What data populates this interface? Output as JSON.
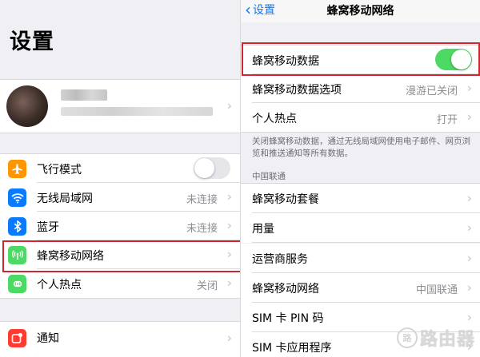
{
  "left": {
    "title": "设置",
    "main_rows": [
      {
        "icon": "airplane-icon",
        "color": "#ff9500",
        "label": "飞行模式",
        "type": "toggle",
        "on": false
      },
      {
        "icon": "wifi-icon",
        "color": "#0a7aff",
        "label": "无线局域网",
        "detail": "未连接"
      },
      {
        "icon": "bluetooth-icon",
        "color": "#0a7aff",
        "label": "蓝牙",
        "detail": "未连接"
      },
      {
        "icon": "cellular-icon",
        "color": "#4cd964",
        "label": "蜂窝移动网络",
        "detail": ""
      },
      {
        "icon": "hotspot-icon",
        "color": "#4cd964",
        "label": "个人热点",
        "detail": "关闭"
      }
    ],
    "notify_row": {
      "icon": "notifications-icon",
      "color": "#ff3b30",
      "label": "通知"
    }
  },
  "right": {
    "back_label": "设置",
    "title": "蜂窝移动网络",
    "data_row": {
      "label": "蜂窝移动数据",
      "on": true
    },
    "options_row": {
      "label": "蜂窝移动数据选项",
      "detail": "漫游已关闭"
    },
    "hotspot_row": {
      "label": "个人热点",
      "detail": "打开"
    },
    "footnote": "关闭蜂窝移动数据，通过无线局域网使用电子邮件、网页浏览和推送通知等所有数据。",
    "carrier_header": "中国联通",
    "carrier_rows": [
      {
        "label": "蜂窝移动套餐",
        "detail": ""
      },
      {
        "label": "用量",
        "detail": ""
      },
      {
        "label": "运营商服务",
        "detail": ""
      },
      {
        "label": "蜂窝移动网络",
        "detail": "中国联通"
      },
      {
        "label": "SIM 卡 PIN 码",
        "detail": ""
      },
      {
        "label": "SIM 卡应用程序",
        "detail": ""
      }
    ]
  },
  "watermark": {
    "logo": "路",
    "text": "路由器"
  },
  "colors": {
    "highlight": "#d0262f",
    "toggle_on": "#4cd964",
    "toggle_off": "#e5e5ea",
    "accent": "#0a7aff"
  }
}
